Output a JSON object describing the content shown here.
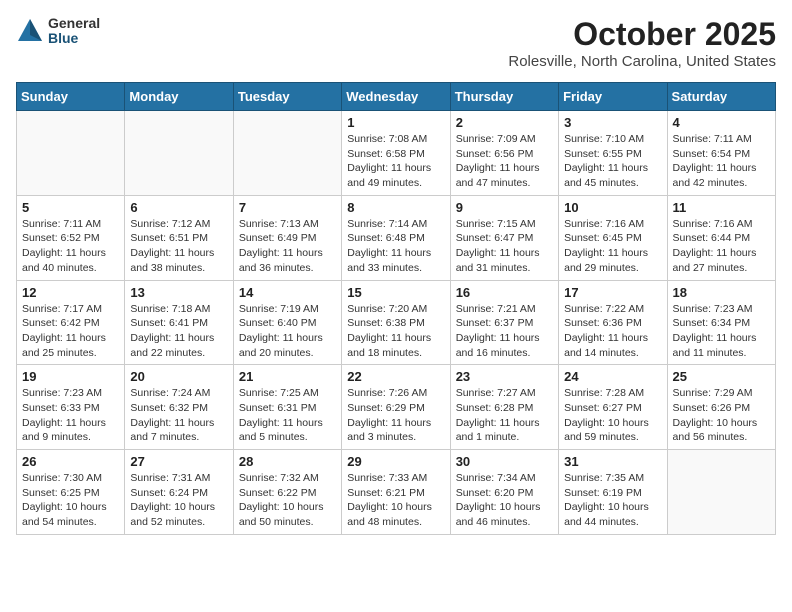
{
  "logo": {
    "general": "General",
    "blue": "Blue"
  },
  "title": "October 2025",
  "location": "Rolesville, North Carolina, United States",
  "weekdays": [
    "Sunday",
    "Monday",
    "Tuesday",
    "Wednesday",
    "Thursday",
    "Friday",
    "Saturday"
  ],
  "weeks": [
    [
      {
        "day": "",
        "info": ""
      },
      {
        "day": "",
        "info": ""
      },
      {
        "day": "",
        "info": ""
      },
      {
        "day": "1",
        "info": "Sunrise: 7:08 AM\nSunset: 6:58 PM\nDaylight: 11 hours\nand 49 minutes."
      },
      {
        "day": "2",
        "info": "Sunrise: 7:09 AM\nSunset: 6:56 PM\nDaylight: 11 hours\nand 47 minutes."
      },
      {
        "day": "3",
        "info": "Sunrise: 7:10 AM\nSunset: 6:55 PM\nDaylight: 11 hours\nand 45 minutes."
      },
      {
        "day": "4",
        "info": "Sunrise: 7:11 AM\nSunset: 6:54 PM\nDaylight: 11 hours\nand 42 minutes."
      }
    ],
    [
      {
        "day": "5",
        "info": "Sunrise: 7:11 AM\nSunset: 6:52 PM\nDaylight: 11 hours\nand 40 minutes."
      },
      {
        "day": "6",
        "info": "Sunrise: 7:12 AM\nSunset: 6:51 PM\nDaylight: 11 hours\nand 38 minutes."
      },
      {
        "day": "7",
        "info": "Sunrise: 7:13 AM\nSunset: 6:49 PM\nDaylight: 11 hours\nand 36 minutes."
      },
      {
        "day": "8",
        "info": "Sunrise: 7:14 AM\nSunset: 6:48 PM\nDaylight: 11 hours\nand 33 minutes."
      },
      {
        "day": "9",
        "info": "Sunrise: 7:15 AM\nSunset: 6:47 PM\nDaylight: 11 hours\nand 31 minutes."
      },
      {
        "day": "10",
        "info": "Sunrise: 7:16 AM\nSunset: 6:45 PM\nDaylight: 11 hours\nand 29 minutes."
      },
      {
        "day": "11",
        "info": "Sunrise: 7:16 AM\nSunset: 6:44 PM\nDaylight: 11 hours\nand 27 minutes."
      }
    ],
    [
      {
        "day": "12",
        "info": "Sunrise: 7:17 AM\nSunset: 6:42 PM\nDaylight: 11 hours\nand 25 minutes."
      },
      {
        "day": "13",
        "info": "Sunrise: 7:18 AM\nSunset: 6:41 PM\nDaylight: 11 hours\nand 22 minutes."
      },
      {
        "day": "14",
        "info": "Sunrise: 7:19 AM\nSunset: 6:40 PM\nDaylight: 11 hours\nand 20 minutes."
      },
      {
        "day": "15",
        "info": "Sunrise: 7:20 AM\nSunset: 6:38 PM\nDaylight: 11 hours\nand 18 minutes."
      },
      {
        "day": "16",
        "info": "Sunrise: 7:21 AM\nSunset: 6:37 PM\nDaylight: 11 hours\nand 16 minutes."
      },
      {
        "day": "17",
        "info": "Sunrise: 7:22 AM\nSunset: 6:36 PM\nDaylight: 11 hours\nand 14 minutes."
      },
      {
        "day": "18",
        "info": "Sunrise: 7:23 AM\nSunset: 6:34 PM\nDaylight: 11 hours\nand 11 minutes."
      }
    ],
    [
      {
        "day": "19",
        "info": "Sunrise: 7:23 AM\nSunset: 6:33 PM\nDaylight: 11 hours\nand 9 minutes."
      },
      {
        "day": "20",
        "info": "Sunrise: 7:24 AM\nSunset: 6:32 PM\nDaylight: 11 hours\nand 7 minutes."
      },
      {
        "day": "21",
        "info": "Sunrise: 7:25 AM\nSunset: 6:31 PM\nDaylight: 11 hours\nand 5 minutes."
      },
      {
        "day": "22",
        "info": "Sunrise: 7:26 AM\nSunset: 6:29 PM\nDaylight: 11 hours\nand 3 minutes."
      },
      {
        "day": "23",
        "info": "Sunrise: 7:27 AM\nSunset: 6:28 PM\nDaylight: 11 hours\nand 1 minute."
      },
      {
        "day": "24",
        "info": "Sunrise: 7:28 AM\nSunset: 6:27 PM\nDaylight: 10 hours\nand 59 minutes."
      },
      {
        "day": "25",
        "info": "Sunrise: 7:29 AM\nSunset: 6:26 PM\nDaylight: 10 hours\nand 56 minutes."
      }
    ],
    [
      {
        "day": "26",
        "info": "Sunrise: 7:30 AM\nSunset: 6:25 PM\nDaylight: 10 hours\nand 54 minutes."
      },
      {
        "day": "27",
        "info": "Sunrise: 7:31 AM\nSunset: 6:24 PM\nDaylight: 10 hours\nand 52 minutes."
      },
      {
        "day": "28",
        "info": "Sunrise: 7:32 AM\nSunset: 6:22 PM\nDaylight: 10 hours\nand 50 minutes."
      },
      {
        "day": "29",
        "info": "Sunrise: 7:33 AM\nSunset: 6:21 PM\nDaylight: 10 hours\nand 48 minutes."
      },
      {
        "day": "30",
        "info": "Sunrise: 7:34 AM\nSunset: 6:20 PM\nDaylight: 10 hours\nand 46 minutes."
      },
      {
        "day": "31",
        "info": "Sunrise: 7:35 AM\nSunset: 6:19 PM\nDaylight: 10 hours\nand 44 minutes."
      },
      {
        "day": "",
        "info": ""
      }
    ]
  ]
}
